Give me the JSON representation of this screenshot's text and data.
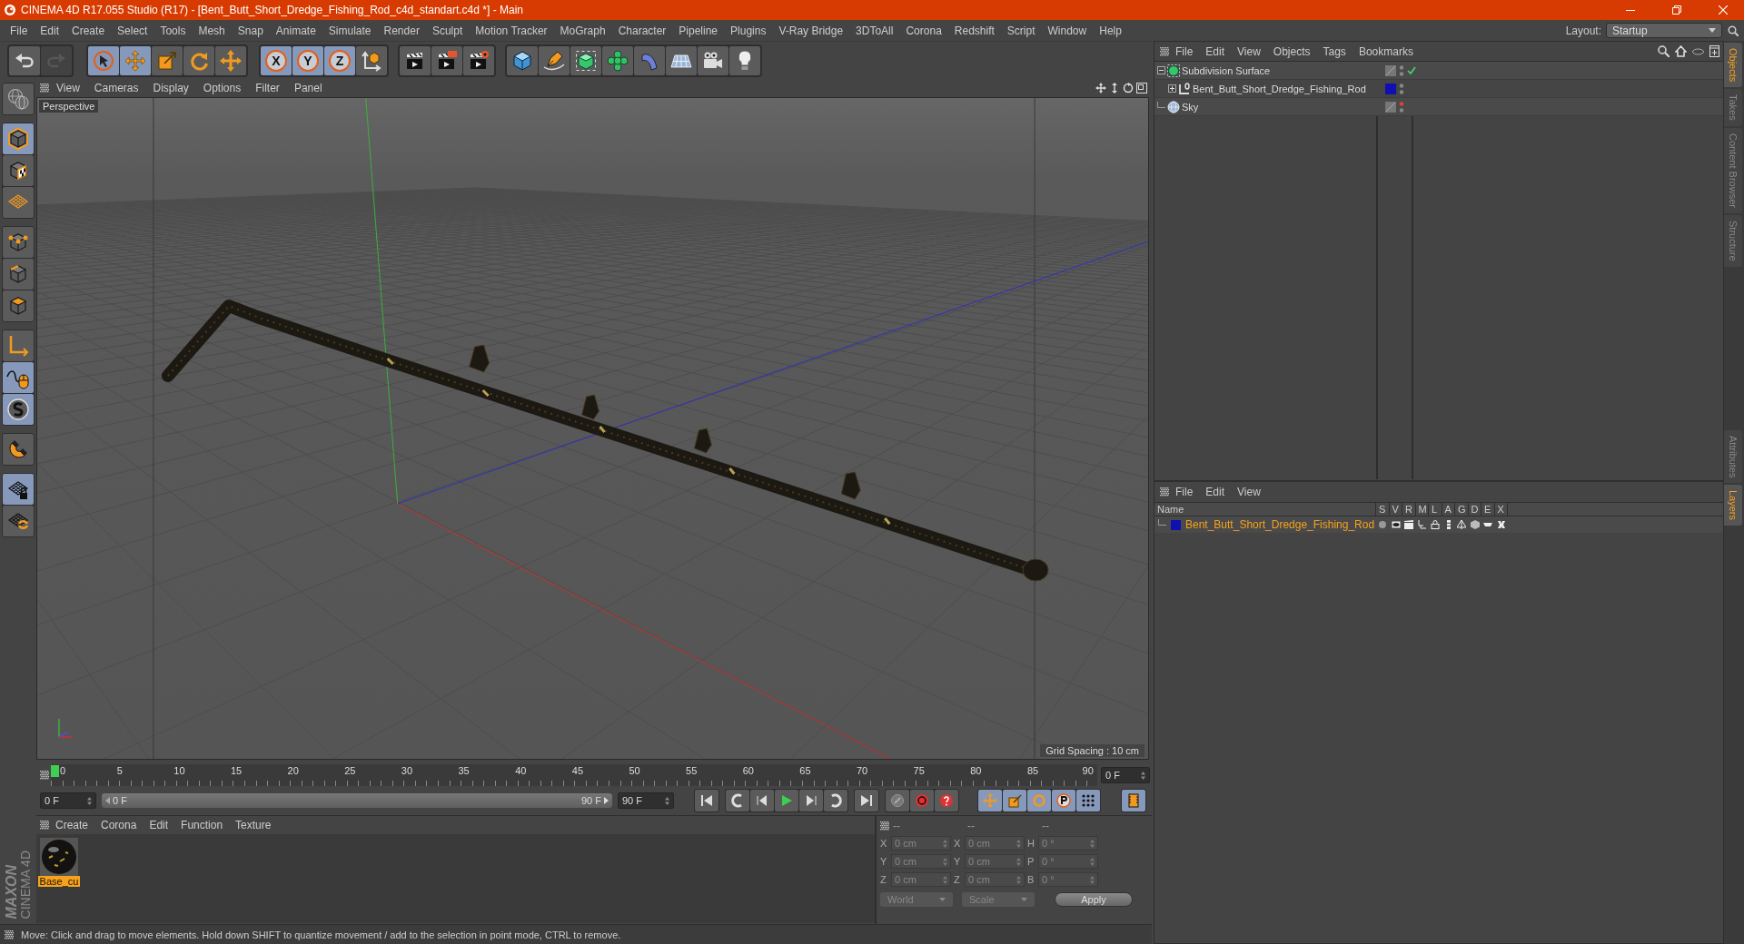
{
  "window": {
    "title": "CINEMA 4D R17.055 Studio (R17) - [Bent_Butt_Short_Dredge_Fishing_Rod_c4d_standart.c4d *] - Main"
  },
  "menu": [
    "File",
    "Edit",
    "Create",
    "Select",
    "Tools",
    "Mesh",
    "Snap",
    "Animate",
    "Simulate",
    "Render",
    "Sculpt",
    "Motion Tracker",
    "MoGraph",
    "Character",
    "Pipeline",
    "Plugins",
    "V-Ray Bridge",
    "3DToAll",
    "Corona",
    "Redshift",
    "Script",
    "Window",
    "Help"
  ],
  "layout": {
    "label": "Layout:",
    "value": "Startup"
  },
  "toolbar": [
    [
      {
        "selected": false,
        "disabled": false
      },
      {
        "selected": false,
        "disabled": true
      }
    ],
    [
      {
        "selected": true,
        "disabled": false
      },
      {
        "selected": true,
        "disabled": false
      },
      {
        "selected": false,
        "disabled": false
      },
      {
        "selected": false,
        "disabled": false
      },
      {
        "selected": false,
        "disabled": false
      }
    ],
    [
      {
        "label": "X",
        "selected": true,
        "disabled": false
      },
      {
        "label": "Y",
        "selected": true,
        "disabled": false
      },
      {
        "label": "Z",
        "selected": true,
        "disabled": false
      },
      {
        "selected": false,
        "disabled": false
      }
    ],
    [
      {
        "selected": false,
        "disabled": false
      },
      {
        "selected": false,
        "disabled": false
      },
      {
        "selected": false,
        "disabled": false
      }
    ],
    [
      {
        "selected": false,
        "disabled": false
      },
      {
        "selected": false,
        "disabled": false
      },
      {
        "selected": false,
        "disabled": false
      },
      {
        "selected": false,
        "disabled": false
      },
      {
        "selected": false,
        "disabled": false
      },
      {
        "selected": false,
        "disabled": false
      },
      {
        "selected": false,
        "disabled": false
      },
      {
        "selected": false,
        "disabled": false
      }
    ]
  ],
  "left_tools": [
    [
      {
        "selected": false
      }
    ],
    [
      {
        "selected": true
      },
      {
        "selected": false
      },
      {
        "selected": false
      }
    ],
    [
      {
        "selected": false
      },
      {
        "selected": false
      },
      {
        "selected": false
      }
    ],
    [
      {
        "selected": false
      },
      {
        "selected": true
      },
      {
        "selected": true
      }
    ],
    [
      {
        "selected": false
      }
    ],
    [
      {
        "selected": true
      },
      {
        "selected": false
      }
    ]
  ],
  "logo": [
    "MAXON",
    "CINEMA 4D"
  ],
  "viewport": {
    "menu": [
      "View",
      "Cameras",
      "Display",
      "Options",
      "Filter",
      "Panel"
    ],
    "camera": "Perspective",
    "grid_spacing": "Grid Spacing : 10 cm"
  },
  "timeline": {
    "range": {
      "level": 1
    },
    "ticks": [
      "0",
      "5",
      "10",
      "15",
      "20",
      "25",
      "30",
      "35",
      "40",
      "45",
      "50",
      "55",
      "60",
      "65",
      "70",
      "75",
      "80",
      "85",
      "90"
    ],
    "playhead": {
      "level": 0
    },
    "current_frame": "0 F",
    "start": "0 F",
    "range_start": "0 F",
    "range_end": "90 F",
    "end": "90 F",
    "modes": [
      {
        "selected": true
      },
      {
        "selected": true
      },
      {
        "selected": true
      },
      {
        "selected": true
      },
      {
        "selected": true
      }
    ]
  },
  "materials": {
    "menu": [
      "Create",
      "Corona",
      "Edit",
      "Function",
      "Texture"
    ],
    "items": [
      {
        "name": "Base_cu",
        "selected": true
      }
    ]
  },
  "coordinates": {
    "headers": [
      "--",
      "--",
      "--"
    ],
    "rows": [
      {
        "axis": "X",
        "position": "0 cm",
        "size_axis": "X",
        "size": "0 cm",
        "rotation_axis": "H",
        "rotation": "0 °"
      },
      {
        "axis": "Y",
        "position": "0 cm",
        "size_axis": "Y",
        "size": "0 cm",
        "rotation_axis": "P",
        "rotation": "0 °"
      },
      {
        "axis": "Z",
        "position": "0 cm",
        "size_axis": "Z",
        "size": "0 cm",
        "rotation_axis": "B",
        "rotation": "0 °"
      }
    ],
    "mode": "World",
    "size_mode": "Scale",
    "apply": "Apply"
  },
  "status_bar": "Move: Click and drag to move elements. Hold down SHIFT to quantize movement / add to the selection in point mode, CTRL to remove.",
  "objects": {
    "menu": [
      "File",
      "Edit",
      "View",
      "Objects",
      "Tags",
      "Bookmarks"
    ],
    "items": [
      {
        "name": "Subdivision Surface",
        "expanded": true,
        "checked": true,
        "render_off": false,
        "children": [
          {
            "name": "Bent_Butt_Short_Dredge_Fishing_Rod",
            "expanded": false,
            "checked": false,
            "render_off": false,
            "color": "#1010b0"
          }
        ]
      },
      {
        "name": "Sky",
        "checked": false,
        "render_off": true
      }
    ]
  },
  "layers": {
    "menu": [
      "File",
      "Edit",
      "View"
    ],
    "columns": [
      "Name",
      "S",
      "V",
      "R",
      "M",
      "L",
      "A",
      "G",
      "D",
      "E",
      "X"
    ],
    "rows": [
      {
        "name": "Bent_Butt_Short_Dredge_Fishing_Rod",
        "color": "#1010b0"
      }
    ]
  },
  "side_tabs_top": [
    {
      "label": "Objects",
      "selected": true
    },
    {
      "label": "Takes",
      "selected": false
    },
    {
      "label": "Content Browser",
      "selected": false
    },
    {
      "label": "Structure",
      "selected": false
    }
  ],
  "side_tabs_bottom": [
    {
      "label": "Attributes",
      "selected": false
    },
    {
      "label": "Layers",
      "selected": true
    }
  ]
}
